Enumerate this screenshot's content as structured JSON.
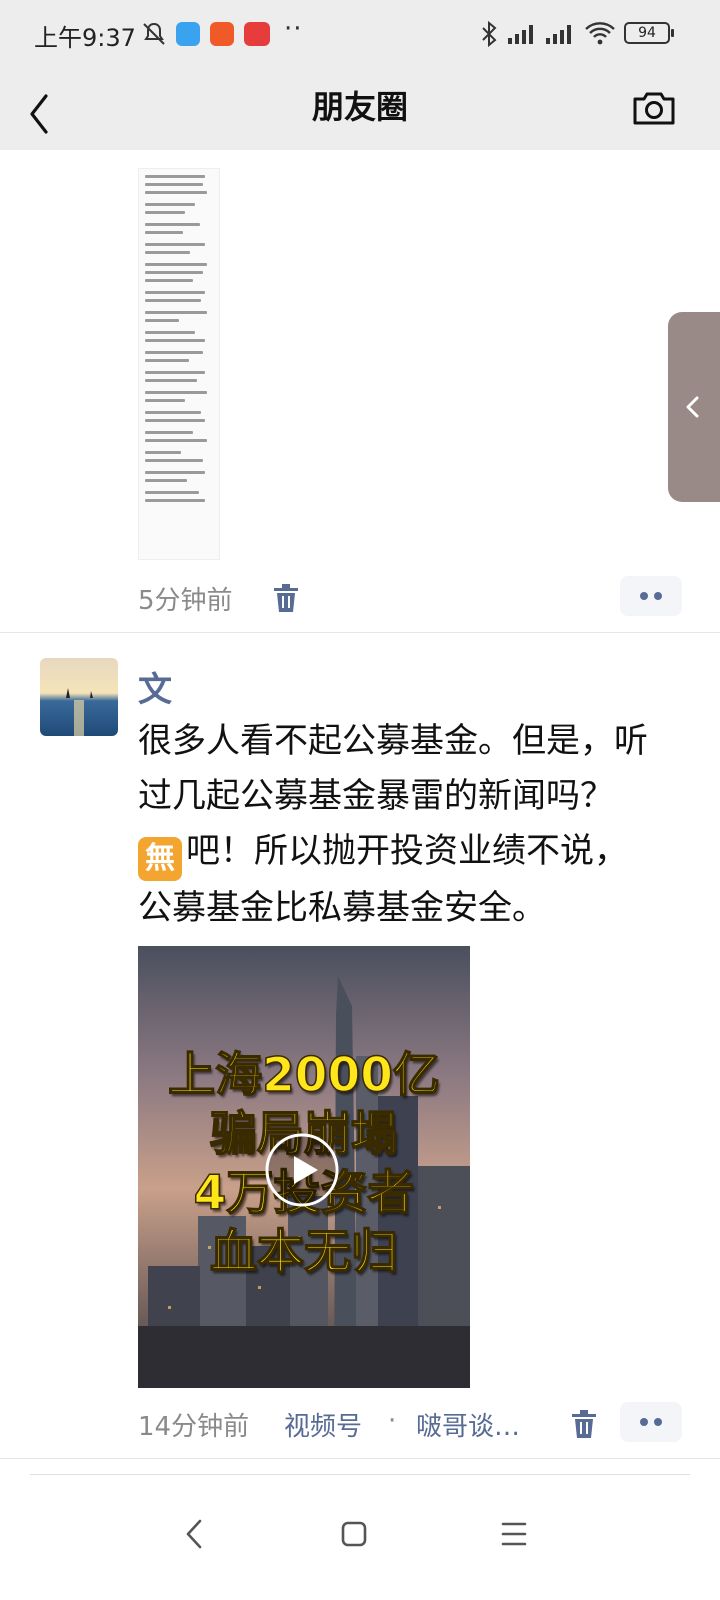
{
  "status_bar": {
    "time": "上午9:37",
    "dots": "··",
    "battery": "94",
    "app_icons": [
      "mute-icon",
      "messenger-app-icon",
      "telegram-app-icon",
      "toutiao-app-icon"
    ],
    "right_icons": [
      "bluetooth-icon",
      "signal-hd-icon",
      "signal-hd-icon",
      "wifi-icon"
    ]
  },
  "nav": {
    "title": "朋友圈"
  },
  "posts": [
    {
      "image": "document-screenshot-thumbnail",
      "time": "5分钟前"
    },
    {
      "author": "文",
      "text_lines": [
        "很多人看不起公募基金。但是，听",
        "过几起公募基金暴雷的新闻吗？",
        "吧！所以抛开投资业绩不说，",
        "公募基金比私募基金安全。"
      ],
      "inline_emoji": "無",
      "video_caption": [
        "上海2000亿",
        "骗局崩塌",
        "4万投资者",
        "血本无归"
      ],
      "time": "14分钟前",
      "channel_label": "视频号",
      "channel_separator": "·",
      "channel_name": "啵哥谈…"
    }
  ],
  "colors": {
    "link": "#576b95",
    "meta": "#8a8a8a",
    "header_bg": "#ededed",
    "emoji_bg": "#f3a530",
    "caption_yellow": "#ffe61a"
  }
}
